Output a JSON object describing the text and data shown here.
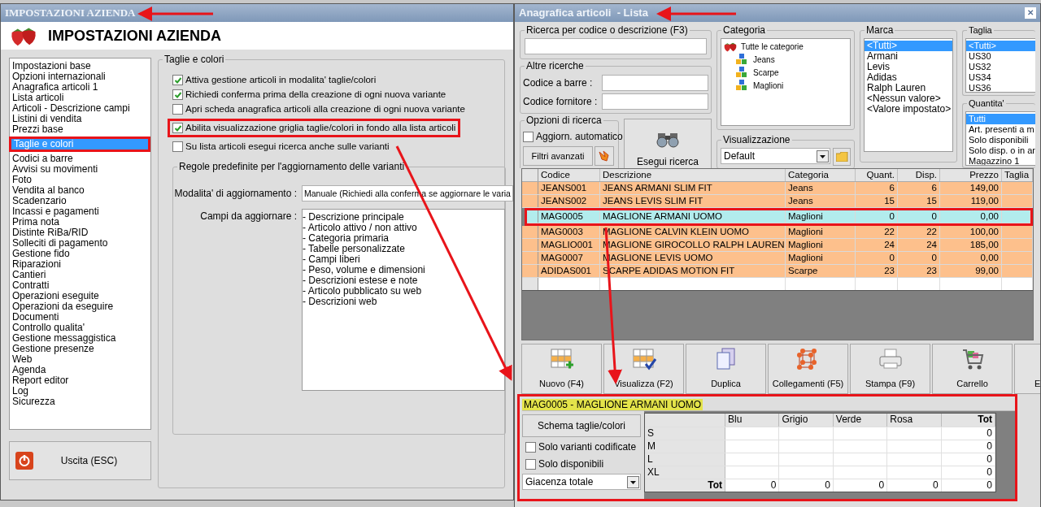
{
  "settings_window": {
    "title": "IMPOSTAZIONI AZIENDA",
    "header_title": "IMPOSTAZIONI AZIENDA",
    "menu": [
      {
        "label": "Impostazioni base",
        "selected": false
      },
      {
        "label": "Opzioni internazionali",
        "selected": false
      },
      {
        "label": "Anagrafica articoli 1",
        "selected": false
      },
      {
        "label": "Lista articoli",
        "selected": false
      },
      {
        "label": "Articoli - Descrizione campi",
        "selected": false
      },
      {
        "label": "Listini di vendita",
        "selected": false
      },
      {
        "label": "Prezzi base",
        "selected": false
      },
      {
        "label": "Taglie e colori",
        "selected": true
      },
      {
        "label": "Codici a barre",
        "selected": false
      },
      {
        "label": "Avvisi su movimenti",
        "selected": false
      },
      {
        "label": "Foto",
        "selected": false
      },
      {
        "label": "Vendita al banco",
        "selected": false
      },
      {
        "label": "Scadenzario",
        "selected": false
      },
      {
        "label": "Incassi e pagamenti",
        "selected": false
      },
      {
        "label": "Prima nota",
        "selected": false
      },
      {
        "label": "Distinte RiBa/RID",
        "selected": false
      },
      {
        "label": "Solleciti di pagamento",
        "selected": false
      },
      {
        "label": "Gestione fido",
        "selected": false
      },
      {
        "label": "Riparazioni",
        "selected": false
      },
      {
        "label": "Cantieri",
        "selected": false
      },
      {
        "label": "Contratti",
        "selected": false
      },
      {
        "label": "Operazioni eseguite",
        "selected": false
      },
      {
        "label": "Operazioni da eseguire",
        "selected": false
      },
      {
        "label": "Documenti",
        "selected": false
      },
      {
        "label": "Controllo qualita'",
        "selected": false
      },
      {
        "label": "Gestione messaggistica",
        "selected": false
      },
      {
        "label": "Gestione presenze",
        "selected": false
      },
      {
        "label": "Web",
        "selected": false
      },
      {
        "label": "Agenda",
        "selected": false
      },
      {
        "label": "Report editor",
        "selected": false
      },
      {
        "label": "Log",
        "selected": false
      },
      {
        "label": "Sicurezza",
        "selected": false
      }
    ],
    "exit_button": "Uscita (ESC)",
    "group_title": "Taglie e colori",
    "options": [
      {
        "label": "Attiva gestione articoli in modalita' taglie/colori",
        "checked": true
      },
      {
        "label": "Richiedi conferma prima della creazione di ogni nuova variante",
        "checked": true
      },
      {
        "label": "Apri scheda anagrafica articoli alla creazione di ogni nuova variante",
        "checked": false
      },
      {
        "label": "Abilita visualizzazione griglia taglie/colori in fondo alla lista articoli",
        "checked": true,
        "annotated": true
      },
      {
        "label": "Su lista articoli esegui ricerca anche sulle varianti",
        "checked": false
      }
    ],
    "rules_title": "Regole predefinite per l'aggiornamento delle varianti",
    "update_mode_label": "Modalita' di aggiornamento :",
    "update_mode_value": "Manuale (Richiedi alla conferma se aggiornare le varia",
    "fields_label": "Campi da aggiornare :",
    "fields": [
      "- Descrizione principale",
      "- Articolo attivo / non attivo",
      "- Categoria primaria",
      "- Tabelle personalizzate",
      "- Campi liberi",
      "- Peso, volume e dimensioni",
      "- Descrizioni estese e note",
      "- Articolo pubblicato su web",
      "- Descrizioni web"
    ]
  },
  "articles_window": {
    "title": "Anagrafica articoli  - Lista",
    "close": "✕",
    "search_title": "Ricerca per codice o descrizione (F3)",
    "other_title": "Altre ricerche",
    "barcode_label": "Codice a barre :",
    "supplier_label": "Codice fornitore :",
    "options_title": "Opzioni di ricerca",
    "auto_update": {
      "label": "Aggiorn. automatico",
      "checked": false
    },
    "advanced_filters": "Filtri avanzati",
    "run_search": "Esegui ricerca",
    "category": {
      "title": "Categoria",
      "root": "Tutte le categorie",
      "children": [
        "Jeans",
        "Scarpe",
        "Maglioni"
      ]
    },
    "view": {
      "title": "Visualizzazione",
      "value": "Default"
    },
    "brand": {
      "title": "Marca",
      "items": [
        {
          "label": "<Tutti>",
          "selected": true
        },
        {
          "label": "Armani",
          "selected": false
        },
        {
          "label": "Levis",
          "selected": false
        },
        {
          "label": "Adidas",
          "selected": false
        },
        {
          "label": "Ralph Lauren",
          "selected": false
        },
        {
          "label": "<Nessun valore>",
          "selected": false
        },
        {
          "label": "<Valore impostato>",
          "selected": false
        }
      ]
    },
    "size": {
      "title": "Taglia",
      "items": [
        {
          "label": "<Tutti>",
          "selected": true
        },
        {
          "label": "US30",
          "selected": false
        },
        {
          "label": "US32",
          "selected": false
        },
        {
          "label": "US34",
          "selected": false
        },
        {
          "label": "US36",
          "selected": false
        }
      ]
    },
    "quantity": {
      "title": "Quantita'",
      "items": [
        {
          "label": "Tutti",
          "selected": true
        },
        {
          "label": "Art. presenti a m",
          "selected": false
        },
        {
          "label": "Solo disponibili",
          "selected": false
        },
        {
          "label": "Solo disp. o in ar",
          "selected": false
        },
        {
          "label": "Magazzino 1",
          "selected": false
        }
      ]
    },
    "table": {
      "columns": [
        "Codice",
        "Descrizione",
        "Categoria",
        "Quant.",
        "Disp.",
        "Prezzo",
        "Taglia"
      ],
      "rows": [
        {
          "cells": [
            "JEANS001",
            "JEANS ARMANI SLIM FIT",
            "Jeans",
            "6",
            "6",
            "149,00"
          ],
          "selected": false
        },
        {
          "cells": [
            "JEANS002",
            "JEANS LEVIS SLIM  FIT",
            "Jeans",
            "15",
            "15",
            "119,00"
          ],
          "selected": false
        },
        {
          "cells": [
            "MAG0005",
            "MAGLIONE ARMANI UOMO",
            "Maglioni",
            "0",
            "0",
            "0,00"
          ],
          "selected": true
        },
        {
          "cells": [
            "MAG0003",
            "MAGLIONE CALVIN KLEIN UOMO",
            "Maglioni",
            "22",
            "22",
            "100,00"
          ],
          "selected": false
        },
        {
          "cells": [
            "MAGLIO001",
            "MAGLIONE GIROCOLLO RALPH LAUREN",
            "Maglioni",
            "24",
            "24",
            "185,00"
          ],
          "selected": false
        },
        {
          "cells": [
            "MAG0007",
            "MAGLIONE LEVIS UOMO",
            "Maglioni",
            "0",
            "0",
            "0,00"
          ],
          "selected": false
        },
        {
          "cells": [
            "ADIDAS001",
            "SCARPE ADIDAS MOTION FIT",
            "Scarpe",
            "23",
            "23",
            "99,00"
          ],
          "selected": false
        }
      ]
    },
    "toolbar": [
      {
        "label": "Nuovo (F4)",
        "kind": "new"
      },
      {
        "label": "Visualizza (F2)",
        "kind": "view"
      },
      {
        "label": "Duplica",
        "kind": "duplicate"
      },
      {
        "label": "Collegamenti (F5)",
        "kind": "links"
      },
      {
        "label": "Stampa (F9)",
        "kind": "print"
      },
      {
        "label": "Carrello",
        "kind": "cart"
      },
      {
        "label": "E",
        "kind": "cut"
      }
    ],
    "variants": {
      "annotated": true,
      "title": "MAG0005 - MAGLIONE ARMANI UOMO",
      "schema_button": "Schema taglie/colori",
      "options": [
        {
          "label": "Solo varianti codificate",
          "checked": false
        },
        {
          "label": "Solo disponibili",
          "checked": false
        }
      ],
      "stock_select": "Giacenza totale",
      "columns": [
        "Blu",
        "Grigio",
        "Verde",
        "Rosa",
        "Tot"
      ],
      "rows": [
        {
          "label": "S",
          "cells": [
            "",
            "",
            "",
            "",
            "0"
          ]
        },
        {
          "label": "M",
          "cells": [
            "",
            "",
            "",
            "",
            "0"
          ]
        },
        {
          "label": "L",
          "cells": [
            "",
            "",
            "",
            "",
            "0"
          ]
        },
        {
          "label": "XL",
          "cells": [
            "",
            "",
            "",
            "",
            "0"
          ]
        },
        {
          "label": "Tot",
          "cells": [
            "0",
            "0",
            "0",
            "0",
            "0"
          ]
        }
      ]
    }
  }
}
